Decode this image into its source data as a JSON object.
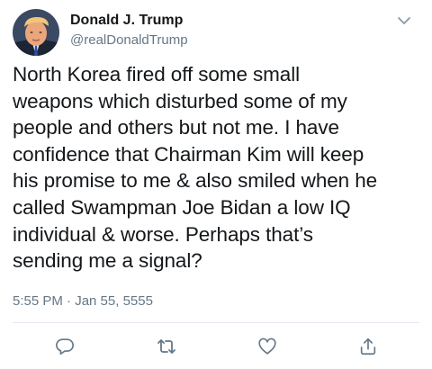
{
  "tweet": {
    "author": {
      "display_name": "Donald J. Trump",
      "handle": "@realDonaldTrump"
    },
    "text": "North Korea fired off some small\nweapons which disturbed some of my\npeople and others but not me. I have\nconfidence that Chairman Kim will keep\nhis promise to me & also smiled when he\ncalled Swampman Joe Bidan a low IQ\nindividual & worse. Perhaps that’s\nsending me a signal?",
    "timestamp": "5:55 PM · Jan 55, 5555"
  },
  "icons": {
    "menu": "chevron-down-icon",
    "reply": "reply-icon",
    "retweet": "retweet-icon",
    "like": "heart-icon",
    "share": "share-icon"
  },
  "colors": {
    "text": "#14171a",
    "secondary": "#657786",
    "divider": "#e1e8ed",
    "action_icon": "#657786"
  }
}
